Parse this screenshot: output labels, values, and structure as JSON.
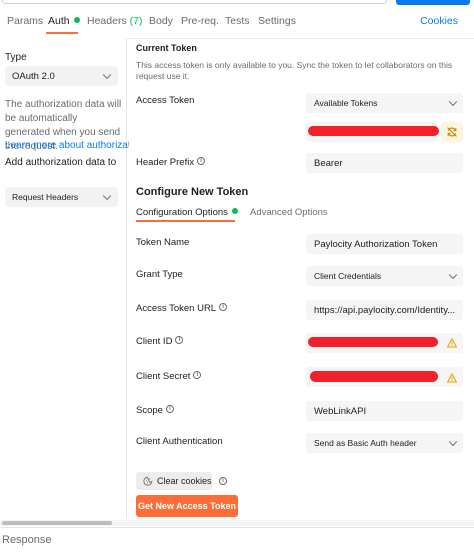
{
  "request_tabs": {
    "params": "Params",
    "auth": "Auth",
    "headers": "Headers",
    "headers_count": "(7)",
    "body": "Body",
    "prereq": "Pre-req.",
    "tests": "Tests",
    "settings": "Settings",
    "cookies": "Cookies"
  },
  "auth_sidebar": {
    "type_label": "Type",
    "type_value": "OAuth 2.0",
    "description": "The authorization data will be automatically generated when you send the request.",
    "learn_more": "Learn more about authorization",
    "add_to_label": "Add authorization data to",
    "add_to_value": "Request Headers"
  },
  "current_token": {
    "heading": "Current Token",
    "note": "This access token is only available to you. Sync the token to let collaborators on this request use it.",
    "access_token_label": "Access Token",
    "available_tokens": "Available Tokens",
    "header_prefix_label": "Header Prefix",
    "header_prefix_value": "Bearer"
  },
  "configure": {
    "title": "Configure New Token",
    "tab_config": "Configuration Options",
    "tab_advanced": "Advanced Options",
    "token_name_label": "Token Name",
    "token_name_value": "Paylocity Authorization Token",
    "grant_type_label": "Grant Type",
    "grant_type_value": "Client Credentials",
    "access_token_url_label": "Access Token URL",
    "access_token_url_value": "https://api.paylocity.com/Identity...",
    "client_id_label": "Client ID",
    "client_secret_label": "Client Secret",
    "scope_label": "Scope",
    "scope_value": "WebLinkAPI",
    "client_auth_label": "Client Authentication",
    "client_auth_value": "Send as Basic Auth header",
    "clear_cookies": "Clear cookies",
    "get_token": "Get New Access Token"
  },
  "response": {
    "label": "Response"
  },
  "colors": {
    "accent": "#ff6c37",
    "link": "#097bed",
    "status_green": "#0cbb52",
    "redaction": "#f2202a",
    "warning": "#e8a200"
  },
  "icons": {
    "info": "info-icon",
    "warning": "warning-icon",
    "sync": "sync-icon",
    "cookie": "cookie-icon",
    "chevron": "chevron-down-icon"
  }
}
